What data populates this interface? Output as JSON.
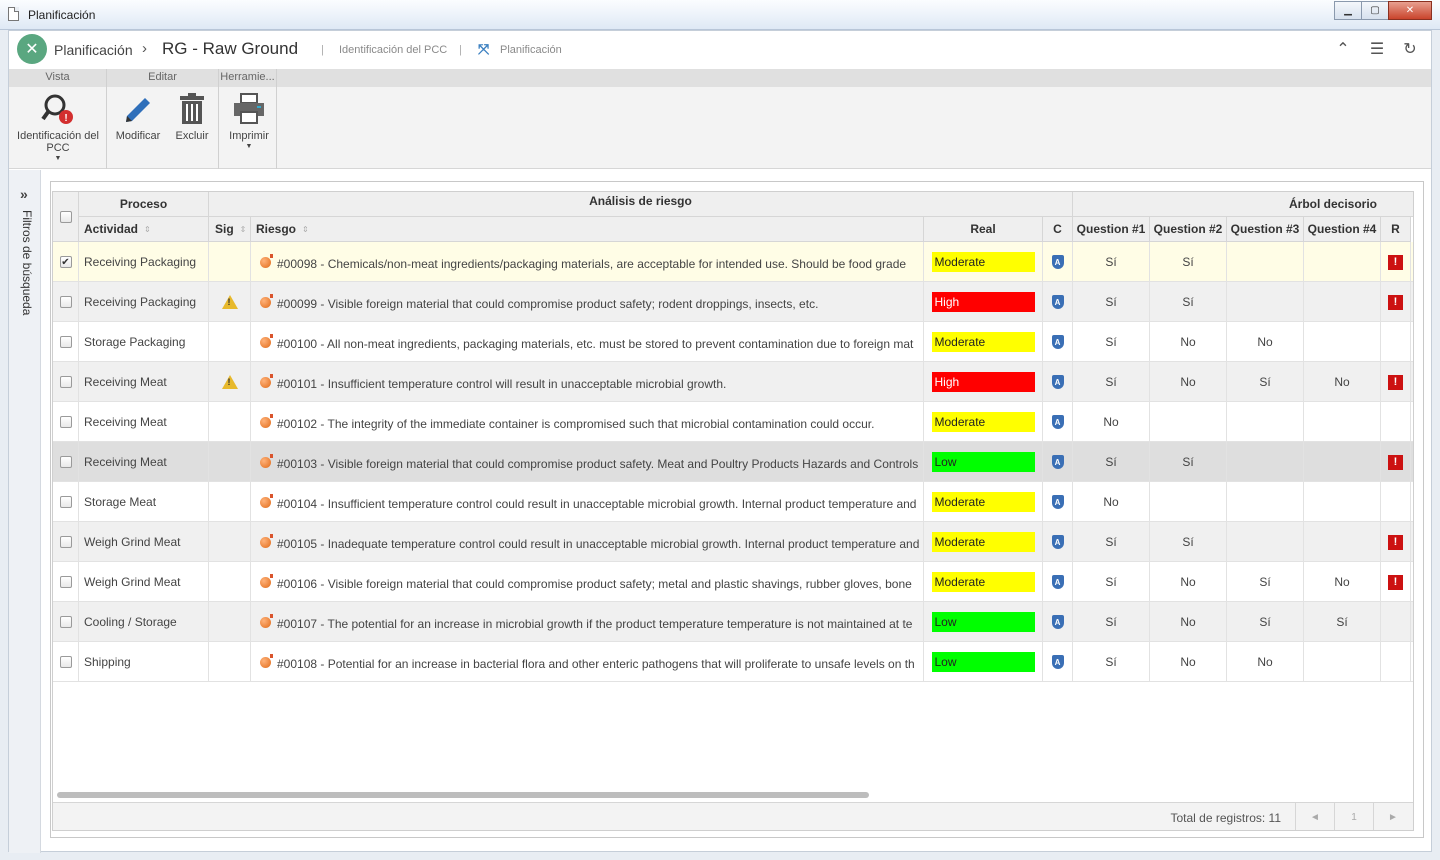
{
  "window": {
    "title": "Planificación"
  },
  "header": {
    "app": "Planificación",
    "record": "RG - Raw Ground",
    "link1": "Identificación del PCC",
    "link2": "Planificación"
  },
  "ribbon": {
    "groups": {
      "vista": "Vista",
      "editar": "Editar",
      "herramientas": "Herramie..."
    },
    "buttons": {
      "identificacion_1": "Identificación del",
      "identificacion_2": "PCC",
      "modificar": "Modificar",
      "excluir": "Excluir",
      "imprimir": "Imprimir"
    }
  },
  "filters": {
    "label": "Filtros de búsqueda"
  },
  "grid": {
    "group_headers": {
      "proceso": "Proceso",
      "analisis": "Análisis de riesgo",
      "arbol": "Árbol decisorio"
    },
    "columns": {
      "actividad": "Actividad",
      "sig": "Sig",
      "riesgo": "Riesgo",
      "real": "Real",
      "c": "C",
      "q1": "Question #1",
      "q2": "Question #2",
      "q3": "Question #3",
      "q4": "Question #4",
      "r": "R"
    },
    "rows": [
      {
        "checked": true,
        "actividad": "Receiving Packaging",
        "sig": false,
        "riesgo": "#00098 - Chemicals/non-meat ingredients/packaging materials, are acceptable for intended use. Should be food grade",
        "real": "Moderate",
        "q1": "Sí",
        "q2": "Sí",
        "q3": "",
        "q4": "",
        "r": true
      },
      {
        "checked": false,
        "actividad": "Receiving Packaging",
        "sig": true,
        "riesgo": "#00099 - Visible foreign material that could compromise product safety; rodent droppings, insects, etc.",
        "real": "High",
        "q1": "Sí",
        "q2": "Sí",
        "q3": "",
        "q4": "",
        "r": true
      },
      {
        "checked": false,
        "actividad": "Storage Packaging",
        "sig": false,
        "riesgo": "#00100 - All non-meat ingredients, packaging materials, etc. must be stored to prevent contamination due to foreign mat",
        "real": "Moderate",
        "q1": "Sí",
        "q2": "No",
        "q3": "No",
        "q4": "",
        "r": false
      },
      {
        "checked": false,
        "actividad": "Receiving Meat",
        "sig": true,
        "riesgo": "#00101 - Insufficient temperature control will result in unacceptable microbial growth.",
        "real": "High",
        "q1": "Sí",
        "q2": "No",
        "q3": "Sí",
        "q4": "No",
        "r": true
      },
      {
        "checked": false,
        "actividad": "Receiving Meat",
        "sig": false,
        "riesgo": "#00102 - The integrity of the immediate container is compromised such that microbial contamination could occur.",
        "real": "Moderate",
        "q1": "No",
        "q2": "",
        "q3": "",
        "q4": "",
        "r": false
      },
      {
        "checked": false,
        "actividad": "Receiving Meat",
        "sig": false,
        "riesgo": "#00103 - Visible foreign material that could compromise product safety. Meat and Poultry Products Hazards and Controls",
        "real": "Low",
        "q1": "Sí",
        "q2": "Sí",
        "q3": "",
        "q4": "",
        "r": true
      },
      {
        "checked": false,
        "actividad": "Storage Meat",
        "sig": false,
        "riesgo": "#00104 - Insufficient temperature control could result in unacceptable microbial growth. Internal product temperature and",
        "real": "Moderate",
        "q1": "No",
        "q2": "",
        "q3": "",
        "q4": "",
        "r": false
      },
      {
        "checked": false,
        "actividad": "Weigh Grind Meat",
        "sig": false,
        "riesgo": "#00105 - Inadequate temperature control could result in unacceptable microbial growth. Internal product temperature and",
        "real": "Moderate",
        "q1": "Sí",
        "q2": "Sí",
        "q3": "",
        "q4": "",
        "r": true
      },
      {
        "checked": false,
        "actividad": "Weigh Grind Meat",
        "sig": false,
        "riesgo": "#00106 - Visible foreign material that could compromise product safety; metal and plastic shavings, rubber gloves, bone",
        "real": "Moderate",
        "q1": "Sí",
        "q2": "No",
        "q3": "Sí",
        "q4": "No",
        "r": true
      },
      {
        "checked": false,
        "actividad": "Cooling / Storage",
        "sig": false,
        "riesgo": "#00107 - The potential for an increase in microbial growth if the product temperature temperature is not maintained at te",
        "real": "Low",
        "q1": "Sí",
        "q2": "No",
        "q3": "Sí",
        "q4": "Sí",
        "r": false
      },
      {
        "checked": false,
        "actividad": "Shipping",
        "sig": false,
        "riesgo": "#00108 - Potential for an increase in bacterial flora and other enteric pathogens that will proliferate to unsafe levels on th",
        "real": "Low",
        "q1": "Sí",
        "q2": "No",
        "q3": "No",
        "q4": "",
        "r": false
      }
    ],
    "level_colors": {
      "Moderate": "#ffff00",
      "High": "#ff0000",
      "Low": "#00ff00"
    },
    "footer": {
      "total": "Total de registros: 11",
      "page": "1"
    }
  }
}
